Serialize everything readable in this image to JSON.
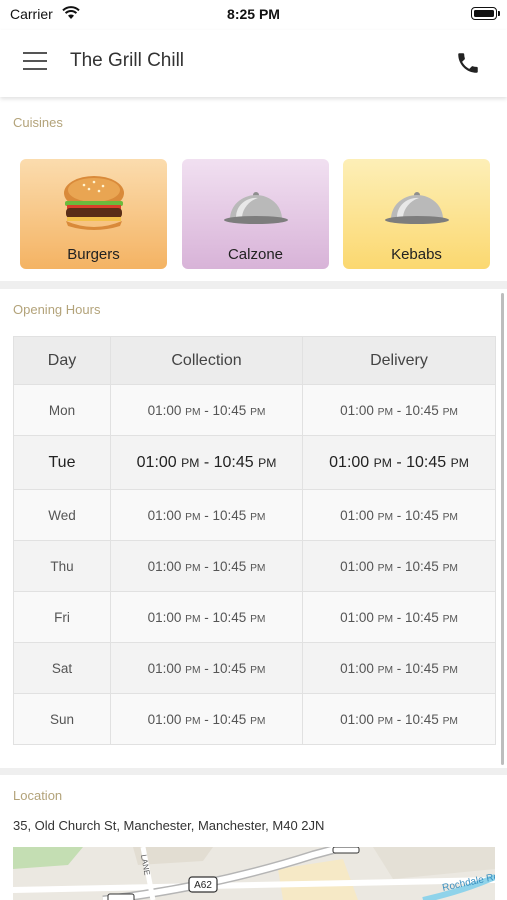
{
  "status_bar": {
    "carrier": "Carrier",
    "time": "8:25 PM"
  },
  "header": {
    "title": "The Grill Chill"
  },
  "cuisines": {
    "label": "Cuisines",
    "items": [
      {
        "name": "Burgers",
        "icon": "burger-image"
      },
      {
        "name": "Calzone",
        "icon": "cloche-image"
      },
      {
        "name": "Kebabs",
        "icon": "cloche-image"
      }
    ]
  },
  "opening_hours": {
    "label": "Opening Hours",
    "columns": [
      "Day",
      "Collection",
      "Delivery"
    ],
    "rows": [
      {
        "day": "Mon",
        "collection": {
          "start": "01:00",
          "start_ampm": "PM",
          "end": "10:45",
          "end_ampm": "PM"
        },
        "delivery": {
          "start": "01:00",
          "start_ampm": "PM",
          "end": "10:45",
          "end_ampm": "PM"
        }
      },
      {
        "day": "Tue",
        "collection": {
          "start": "01:00",
          "start_ampm": "PM",
          "end": "10:45",
          "end_ampm": "PM"
        },
        "delivery": {
          "start": "01:00",
          "start_ampm": "PM",
          "end": "10:45",
          "end_ampm": "PM"
        }
      },
      {
        "day": "Wed",
        "collection": {
          "start": "01:00",
          "start_ampm": "PM",
          "end": "10:45",
          "end_ampm": "PM"
        },
        "delivery": {
          "start": "01:00",
          "start_ampm": "PM",
          "end": "10:45",
          "end_ampm": "PM"
        }
      },
      {
        "day": "Thu",
        "collection": {
          "start": "01:00",
          "start_ampm": "PM",
          "end": "10:45",
          "end_ampm": "PM"
        },
        "delivery": {
          "start": "01:00",
          "start_ampm": "PM",
          "end": "10:45",
          "end_ampm": "PM"
        }
      },
      {
        "day": "Fri",
        "collection": {
          "start": "01:00",
          "start_ampm": "PM",
          "end": "10:45",
          "end_ampm": "PM"
        },
        "delivery": {
          "start": "01:00",
          "start_ampm": "PM",
          "end": "10:45",
          "end_ampm": "PM"
        }
      },
      {
        "day": "Sat",
        "collection": {
          "start": "01:00",
          "start_ampm": "PM",
          "end": "10:45",
          "end_ampm": "PM"
        },
        "delivery": {
          "start": "01:00",
          "start_ampm": "PM",
          "end": "10:45",
          "end_ampm": "PM"
        }
      },
      {
        "day": "Sun",
        "collection": {
          "start": "01:00",
          "start_ampm": "PM",
          "end": "10:45",
          "end_ampm": "PM"
        },
        "delivery": {
          "start": "01:00",
          "start_ampm": "PM",
          "end": "10:45",
          "end_ampm": "PM"
        }
      }
    ]
  },
  "location": {
    "label": "Location",
    "address": "35, Old Church St, Manchester, Manchester, M40 2JN",
    "map": {
      "road_label": "A62",
      "street_label": "Rochdale Rd",
      "lane_label": "LANE"
    }
  },
  "colors": {
    "section_label": "#b3a37a",
    "separator": "#efefef"
  }
}
